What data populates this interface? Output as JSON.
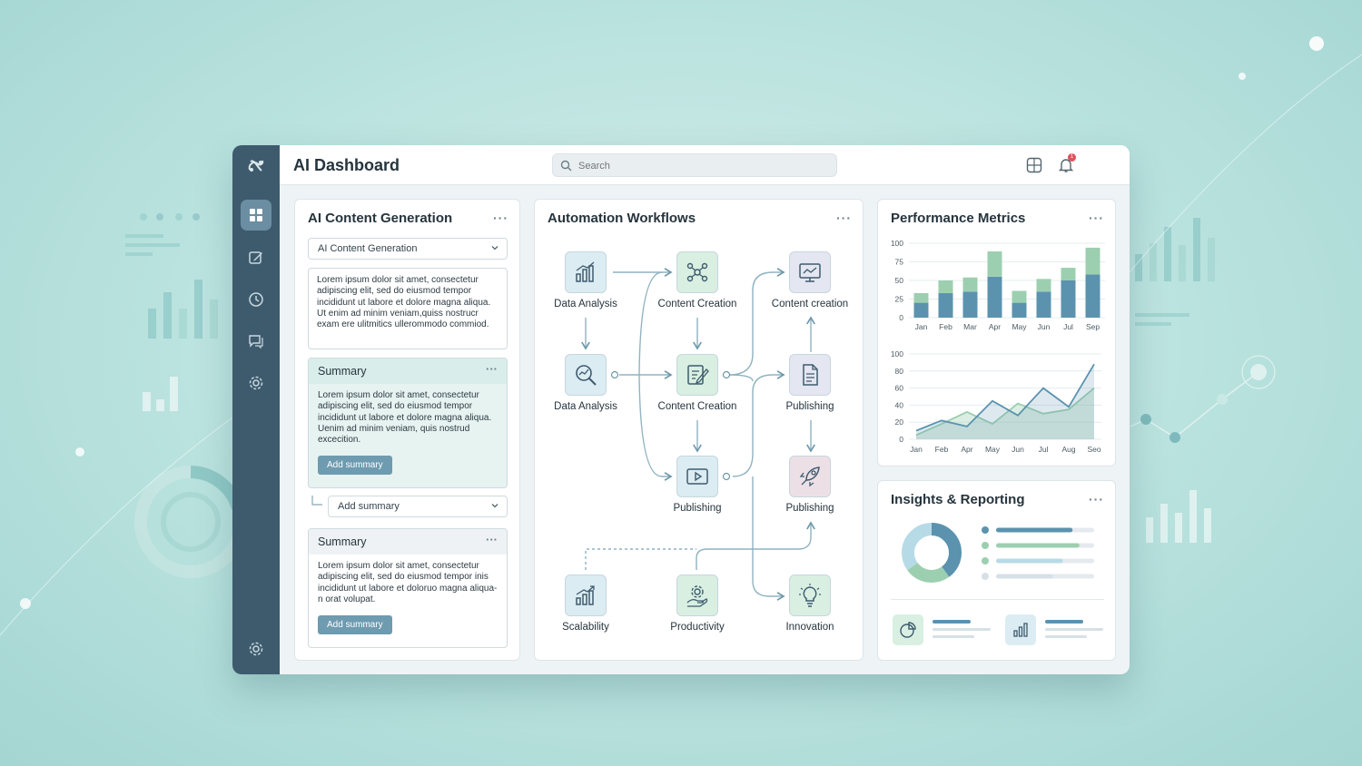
{
  "app": {
    "title": "AI Dashboard"
  },
  "search": {
    "placeholder": "Search"
  },
  "notifications": {
    "count": "1"
  },
  "sidebar": {
    "items": [
      {
        "name": "logo",
        "icon": "ai-logo-icon"
      },
      {
        "name": "dashboard",
        "icon": "grid-icon",
        "active": true
      },
      {
        "name": "editor",
        "icon": "edit-icon"
      },
      {
        "name": "history",
        "icon": "clock-icon"
      },
      {
        "name": "messages",
        "icon": "chat-icon"
      },
      {
        "name": "settings",
        "icon": "gear-icon"
      }
    ],
    "bottom_icon": "gear-icon"
  },
  "content_generation": {
    "title": "AI Content Generation",
    "select_value": "AI Content Generation",
    "textbox": "Lorem ipsum dolor sit amet, consectetur adipiscing elit, sed do eiusmod tempor incididunt ut labore et dolore magna aliqua. Ut enim ad minim veniam,quiss nostrucr exam ere ulitmitics ullerommodo commiod.",
    "summary1": {
      "title": "Summary",
      "body": "Lorem ipsum dolor sit amet, consectetur adipiscing elit, sed do eiusmod tempor incididunt ut labore et dolore magna aliqua. Uenim ad minim veniam, quis nostrud excecition.",
      "button": "Add summary"
    },
    "add_summary_select": "Add summary",
    "summary2": {
      "title": "Summary",
      "body": "Lorem ipsum dolor sit amet, consectetur adipiscing elit, sed do eiusmod tempor inis incididunt ut labore et doloruo magna aliqua-n orat volupat.",
      "button": "Add summary"
    }
  },
  "workflows": {
    "title": "Automation Workflows",
    "nodes": [
      {
        "label": "Data Analysis",
        "icon": "bar-chart-icon"
      },
      {
        "label": "Content Creation",
        "icon": "network-icon"
      },
      {
        "label": "Content creation",
        "icon": "monitor-chart-icon"
      },
      {
        "label": "Data Analysis",
        "icon": "magnifier-chart-icon"
      },
      {
        "label": "Content Creation",
        "icon": "document-edit-icon"
      },
      {
        "label": "Publishing",
        "icon": "document-icon"
      },
      {
        "label": "Publishing",
        "icon": "video-play-icon"
      },
      {
        "label": "Publishing",
        "icon": "rocket-icon"
      },
      {
        "label": "Scalability",
        "icon": "growth-chart-icon"
      },
      {
        "label": "Productivity",
        "icon": "gear-hand-icon"
      },
      {
        "label": "Innovation",
        "icon": "lightbulb-icon"
      }
    ]
  },
  "performance": {
    "title": "Performance Metrics"
  },
  "insights": {
    "title": "Insights & Reporting",
    "donut": [
      0.4,
      0.25,
      0.35
    ],
    "bars": [
      0.78,
      0.85,
      0.68,
      0.58
    ]
  },
  "chart_data": [
    {
      "type": "bar",
      "categories": [
        "Jan",
        "Feb",
        "Mar",
        "Apr",
        "May",
        "Jun",
        "Jul",
        "Sep"
      ],
      "series": [
        {
          "values": [
            20,
            33,
            35,
            55,
            20,
            35,
            50,
            58
          ]
        },
        {
          "values": [
            13,
            17,
            19,
            34,
            16,
            17,
            17,
            36
          ]
        }
      ],
      "stacked": true,
      "ylim": [
        0,
        100
      ],
      "yticks": [
        0,
        25,
        50,
        75,
        100
      ],
      "grid": true,
      "colors": [
        "#5b93af",
        "#9ccfb0"
      ]
    },
    {
      "type": "line",
      "categories": [
        "Jan",
        "Feb",
        "Apr",
        "May",
        "Jun",
        "Jul",
        "Aug",
        "Seo"
      ],
      "series": [
        {
          "values": [
            5,
            18,
            32,
            18,
            42,
            30,
            35,
            60
          ],
          "color": "#9ccfb0"
        },
        {
          "values": [
            10,
            22,
            15,
            45,
            28,
            60,
            38,
            88
          ],
          "color": "#5b93af"
        }
      ],
      "ylim": [
        0,
        100
      ],
      "yticks": [
        0,
        20,
        40,
        60,
        80,
        100
      ],
      "grid": true,
      "area": true
    }
  ],
  "colors": {
    "accent": "#6e9bb0",
    "sidebar": "#3e5b6e",
    "green": "#9ccfb0",
    "blue": "#5b93af"
  }
}
